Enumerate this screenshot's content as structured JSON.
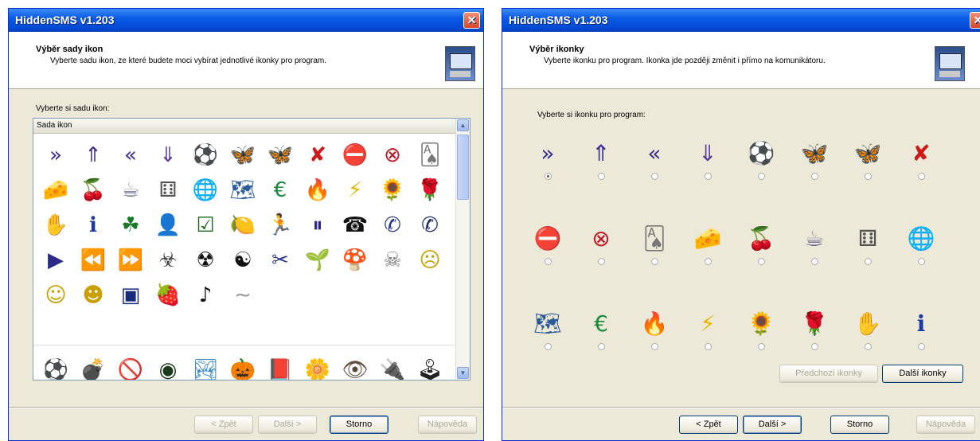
{
  "left_window": {
    "title": "HiddenSMS v1.203",
    "close_glyph": "✕",
    "header_title": "Výběr sady ikon",
    "header_subtitle": "Vyberte sadu ikon, ze které budete moci vybírat jednotlivé ikonky pro program.",
    "list_label": "Vyberte si sadu ikon:",
    "column_header": "Sada ikon",
    "scroll_up": "▲",
    "scroll_down": "▼",
    "icon_grid": [
      {
        "name": "double-right-arrow-icon",
        "glyph": "»",
        "color": "#3b2f8f"
      },
      {
        "name": "double-up-arrow-icon",
        "glyph": "⇑",
        "color": "#3b2f8f"
      },
      {
        "name": "double-left-arrow-icon",
        "glyph": "«",
        "color": "#3b2f8f"
      },
      {
        "name": "double-down-arrow-icon",
        "glyph": "⇓",
        "color": "#5a3a9a"
      },
      {
        "name": "soccer-ball-icon",
        "glyph": "⚽",
        "color": "#222222"
      },
      {
        "name": "butterfly-green-icon",
        "glyph": "🦋",
        "color": "#6a8a2a"
      },
      {
        "name": "butterfly-dark-icon",
        "glyph": "🦋",
        "color": "#4a3a2a"
      },
      {
        "name": "red-x-mark-icon",
        "glyph": "✘",
        "color": "#cc1a1a"
      },
      {
        "name": "stop-sign-icon",
        "glyph": "⛔",
        "color": "#cc1a1a"
      },
      {
        "name": "red-circle-x-icon",
        "glyph": "⊗",
        "color": "#c01a2a"
      },
      {
        "name": "playing-cards-icon",
        "glyph": "🂡",
        "color": "#777777"
      },
      {
        "name": "cheese-icon",
        "glyph": "🧀",
        "color": "#e6c200"
      },
      {
        "name": "cherries-icon",
        "glyph": "🍒",
        "color": "#cc1a1a"
      },
      {
        "name": "coffee-cup-icon",
        "glyph": "☕",
        "color": "#6b6b8f"
      },
      {
        "name": "dice-icon",
        "glyph": "⚅",
        "color": "#555555"
      },
      {
        "name": "globe-icon",
        "glyph": "🌐",
        "color": "#1a2a4a"
      },
      {
        "name": "world-map-icon",
        "glyph": "🗺",
        "color": "#2a5a9a"
      },
      {
        "name": "euro-icon",
        "glyph": "€",
        "color": "#1a8a3a"
      },
      {
        "name": "fire-icon",
        "glyph": "🔥",
        "color": "#c0301a"
      },
      {
        "name": "lightning-icon",
        "glyph": "⚡",
        "color": "#e6b800"
      },
      {
        "name": "sunflower-icon",
        "glyph": "🌻",
        "color": "#c89a10"
      },
      {
        "name": "rose-icon",
        "glyph": "🌹",
        "color": "#c0201a"
      },
      {
        "name": "hand-print-icon",
        "glyph": "✋",
        "color": "#cc1a1a"
      },
      {
        "name": "info-icon",
        "glyph": "ℹ",
        "color": "#1a3aa0"
      },
      {
        "name": "leaf-icon",
        "glyph": "☘",
        "color": "#1a7a2a"
      },
      {
        "name": "person-icon",
        "glyph": "👤",
        "color": "#111111"
      },
      {
        "name": "checkbox-checked-icon",
        "glyph": "☑",
        "color": "#1a6a1a"
      },
      {
        "name": "lemon-icon",
        "glyph": "🍋",
        "color": "#e6b800"
      },
      {
        "name": "runner-icon",
        "glyph": "🏃",
        "color": "#b0201a"
      },
      {
        "name": "pause-button-icon",
        "glyph": "⏸",
        "color": "#2a2a8a"
      },
      {
        "name": "telephone-icon",
        "glyph": "☎",
        "color": "#111111"
      },
      {
        "name": "phone-handset-icon",
        "glyph": "✆",
        "color": "#2a3a8a"
      },
      {
        "name": "phone-circle-icon",
        "glyph": "✆",
        "color": "#1a2a6a"
      },
      {
        "name": "play-button-icon",
        "glyph": "▶",
        "color": "#2a2a8a"
      },
      {
        "name": "rewind-button-icon",
        "glyph": "⏪",
        "color": "#2a2a8a"
      },
      {
        "name": "fast-forward-button-icon",
        "glyph": "⏩",
        "color": "#2a2a8a"
      },
      {
        "name": "biohazard-icon",
        "glyph": "☣",
        "color": "#444444"
      },
      {
        "name": "radioactive-icon",
        "glyph": "☢",
        "color": "#111111"
      },
      {
        "name": "yin-yang-icon",
        "glyph": "☯",
        "color": "#111111"
      },
      {
        "name": "scissors-icon",
        "glyph": "✂",
        "color": "#2a3a8a"
      },
      {
        "name": "plant-icon",
        "glyph": "🌱",
        "color": "#8a3a2a"
      },
      {
        "name": "mushroom-icon",
        "glyph": "🍄",
        "color": "#a0201a"
      },
      {
        "name": "skull-crossbones-icon",
        "glyph": "☠",
        "color": "#777777"
      },
      {
        "name": "angry-smiley-icon",
        "glyph": "☹",
        "color": "#c8a000"
      },
      {
        "name": "goggle-smiley-icon",
        "glyph": "☺",
        "color": "#c8a000"
      },
      {
        "name": "grin-smiley-icon",
        "glyph": "☻",
        "color": "#c8a000"
      },
      {
        "name": "card-icon",
        "glyph": "▣",
        "color": "#1a2a7a"
      },
      {
        "name": "strawberry-icon",
        "glyph": "🍓",
        "color": "#cc1a1a"
      },
      {
        "name": "music-note-icon",
        "glyph": "♪",
        "color": "#111111"
      },
      {
        "name": "squiggle-icon",
        "glyph": "∼",
        "color": "#999999"
      }
    ],
    "icon_row2": [
      {
        "name": "soccer-box-icon",
        "glyph": "⚽",
        "color": "#4a6a2a"
      },
      {
        "name": "bomb-icon",
        "glyph": "💣",
        "color": "#444444"
      },
      {
        "name": "no-entry-icon",
        "glyph": "🚫",
        "color": "#cc1a1a"
      },
      {
        "name": "dark-orb-icon",
        "glyph": "◉",
        "color": "#1a3a1a"
      },
      {
        "name": "landscape-icon",
        "glyph": "🏞",
        "color": "#3a8ad0"
      },
      {
        "name": "pumpkin-icon",
        "glyph": "🎃",
        "color": "#e06a00"
      },
      {
        "name": "book-icon",
        "glyph": "📕",
        "color": "#8a1a1a"
      },
      {
        "name": "flower-icon",
        "glyph": "🌼",
        "color": "#e0a000"
      },
      {
        "name": "eye-icon",
        "glyph": "👁",
        "color": "#5a4a3a"
      },
      {
        "name": "usb-stick-icon",
        "glyph": "🔌",
        "color": "#7a7aaa"
      },
      {
        "name": "joystick-icon",
        "glyph": "🕹",
        "color": "#222222"
      }
    ],
    "buttons": {
      "back": "< Zpět",
      "next": "Další >",
      "cancel": "Storno",
      "help": "Nápověda"
    }
  },
  "right_window": {
    "title": "HiddenSMS v1.203",
    "close_glyph": "✕",
    "header_title": "Výběr ikonky",
    "header_subtitle": "Vyberte ikonku pro program. Ikonka jde později změnit i přímo na komunikátoru.",
    "choose_label": "Vyberte si ikonku pro program:",
    "options": [
      {
        "name": "double-right-arrow-icon",
        "glyph": "»",
        "color": "#3b2f8f",
        "selected": true
      },
      {
        "name": "double-up-arrow-icon",
        "glyph": "⇑",
        "color": "#3b2f8f",
        "selected": false
      },
      {
        "name": "double-left-arrow-icon",
        "glyph": "«",
        "color": "#3b2f8f",
        "selected": false
      },
      {
        "name": "double-down-arrow-icon",
        "glyph": "⇓",
        "color": "#5a3a9a",
        "selected": false
      },
      {
        "name": "soccer-ball-icon",
        "glyph": "⚽",
        "color": "#222222",
        "selected": false
      },
      {
        "name": "butterfly-green-icon",
        "glyph": "🦋",
        "color": "#6a8a2a",
        "selected": false
      },
      {
        "name": "butterfly-dark-icon",
        "glyph": "🦋",
        "color": "#4a3a2a",
        "selected": false
      },
      {
        "name": "red-x-mark-icon",
        "glyph": "✘",
        "color": "#cc1a1a",
        "selected": false
      },
      {
        "name": "stop-sign-icon",
        "glyph": "⛔",
        "color": "#cc1a1a",
        "selected": false
      },
      {
        "name": "red-circle-x-icon",
        "glyph": "⊗",
        "color": "#c01a2a",
        "selected": false
      },
      {
        "name": "playing-cards-icon",
        "glyph": "🂡",
        "color": "#777777",
        "selected": false
      },
      {
        "name": "cheese-icon",
        "glyph": "🧀",
        "color": "#e6c200",
        "selected": false
      },
      {
        "name": "cherries-icon",
        "glyph": "🍒",
        "color": "#cc1a1a",
        "selected": false
      },
      {
        "name": "coffee-cup-icon",
        "glyph": "☕",
        "color": "#6b6b8f",
        "selected": false
      },
      {
        "name": "dice-icon",
        "glyph": "⚅",
        "color": "#555555",
        "selected": false
      },
      {
        "name": "globe-icon",
        "glyph": "🌐",
        "color": "#1a2a4a",
        "selected": false
      },
      {
        "name": "world-map-icon",
        "glyph": "🗺",
        "color": "#2a5a9a",
        "selected": false
      },
      {
        "name": "euro-icon",
        "glyph": "€",
        "color": "#1a8a3a",
        "selected": false
      },
      {
        "name": "fire-icon",
        "glyph": "🔥",
        "color": "#c0301a",
        "selected": false
      },
      {
        "name": "lightning-icon",
        "glyph": "⚡",
        "color": "#e6b800",
        "selected": false
      },
      {
        "name": "sunflower-icon",
        "glyph": "🌻",
        "color": "#c89a10",
        "selected": false
      },
      {
        "name": "rose-icon",
        "glyph": "🌹",
        "color": "#c0201a",
        "selected": false
      },
      {
        "name": "hand-print-icon",
        "glyph": "✋",
        "color": "#cc1a1a",
        "selected": false
      },
      {
        "name": "info-icon",
        "glyph": "ℹ",
        "color": "#1a3aa0",
        "selected": false
      }
    ],
    "buttons": {
      "prev_icons": "Předchozí ikonky",
      "next_icons": "Další ikonky",
      "back": "< Zpět",
      "next": "Další >",
      "cancel": "Storno",
      "help": "Nápověda"
    }
  }
}
